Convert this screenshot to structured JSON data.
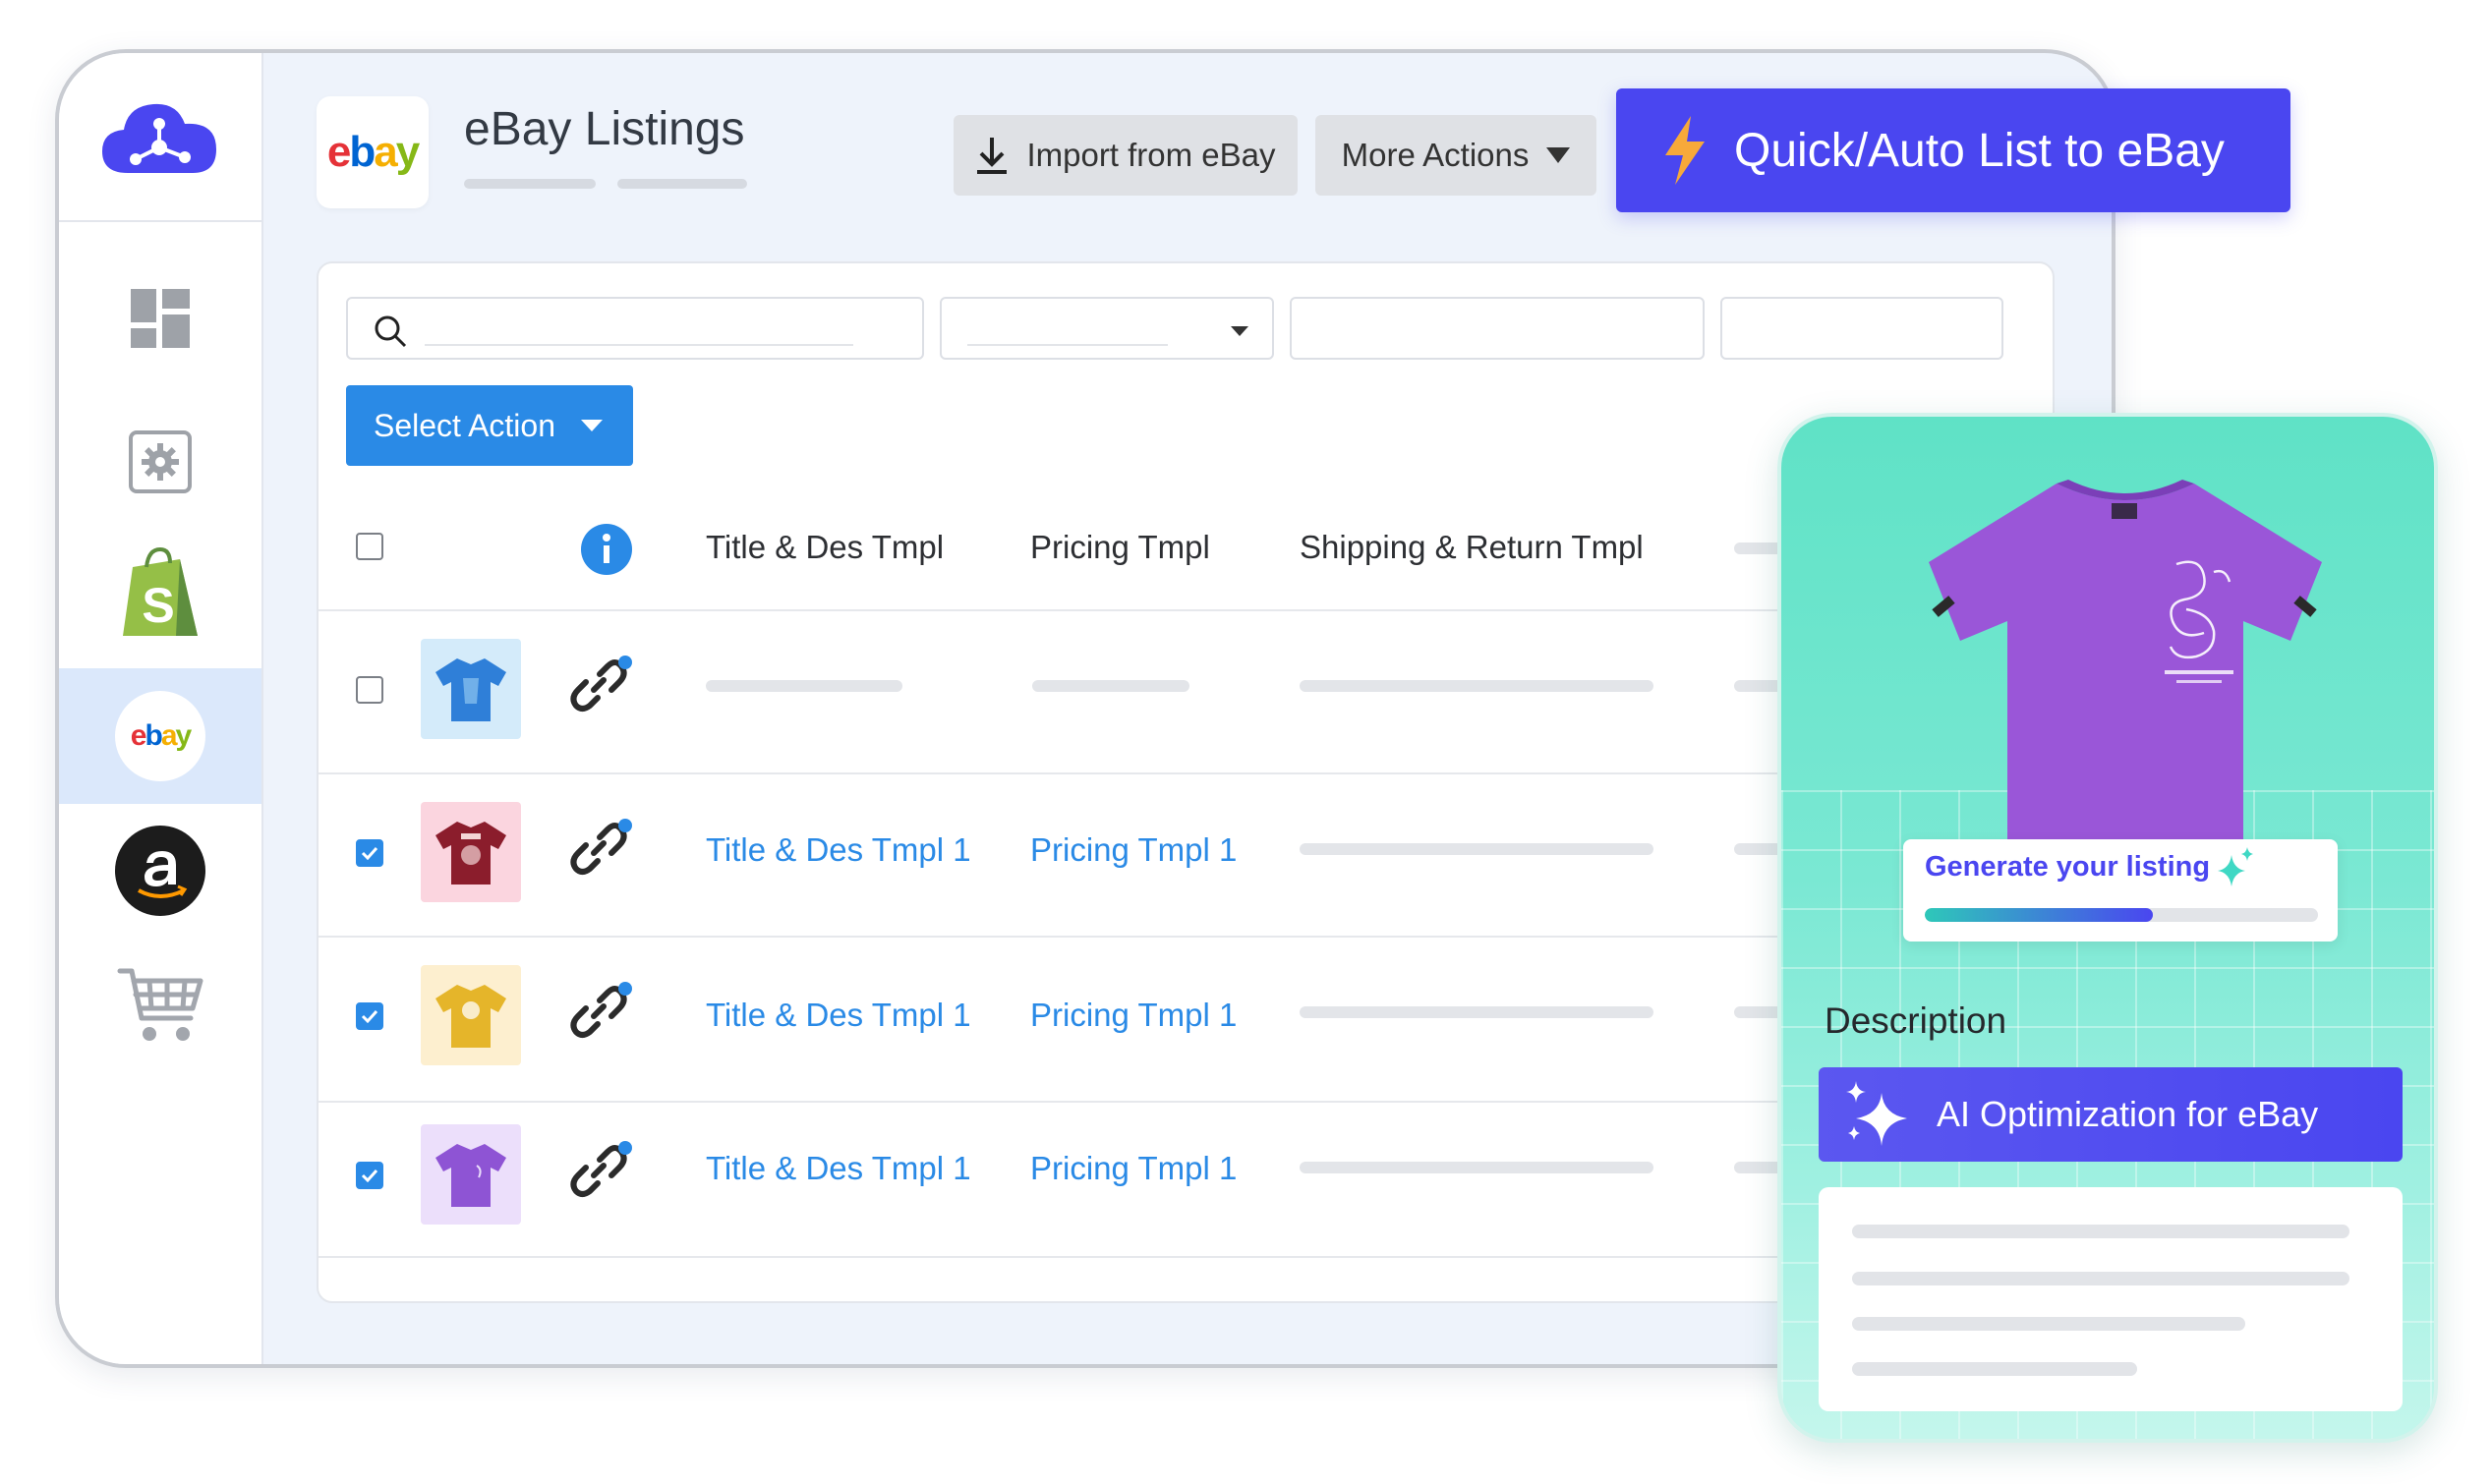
{
  "header": {
    "title": "eBay Listings",
    "import_button": "Import from eBay",
    "more_actions_button": "More Actions",
    "quick_list_button": "Quick/Auto List to eBay"
  },
  "sidebar": {
    "items": [
      {
        "name": "logo",
        "icon": "cloud-network-icon",
        "color": "#4a46f0"
      },
      {
        "name": "dashboard",
        "icon": "dashboard-grid-icon"
      },
      {
        "name": "settings",
        "icon": "gear-icon"
      },
      {
        "name": "shopify",
        "icon": "shopify-bag-icon",
        "color": "#95bf47"
      },
      {
        "name": "ebay",
        "icon": "ebay-logo-icon",
        "active": true
      },
      {
        "name": "amazon",
        "icon": "amazon-logo-icon"
      },
      {
        "name": "cart",
        "icon": "cart-icon"
      }
    ],
    "ebay_logo": {
      "e": "e",
      "b": "b",
      "a": "a",
      "y": "y"
    }
  },
  "toolbar": {
    "select_action": "Select Action"
  },
  "table": {
    "columns": [
      "Title & Des Tmpl",
      "Pricing Tmpl",
      "Shipping & Return Tmpl"
    ],
    "rows": [
      {
        "checked": false,
        "thumb_color": "#2f7fd8",
        "thumb_bg": "#d4ebfa",
        "title_tmpl": "",
        "pricing_tmpl": ""
      },
      {
        "checked": true,
        "thumb_color": "#8b1d2c",
        "thumb_bg": "#fbd5df",
        "title_tmpl": "Title & Des Tmpl 1",
        "pricing_tmpl": "Pricing Tmpl 1"
      },
      {
        "checked": true,
        "thumb_color": "#e5b52a",
        "thumb_bg": "#fdefcf",
        "title_tmpl": "Title & Des Tmpl 1",
        "pricing_tmpl": "Pricing Tmpl 1"
      },
      {
        "checked": true,
        "thumb_color": "#8e54d4",
        "thumb_bg": "#ecdffb",
        "title_tmpl": "Title & Des Tmpl 1",
        "pricing_tmpl": "Pricing Tmpl 1"
      }
    ]
  },
  "ai_card": {
    "generate_label": "Generate your listing",
    "progress": 0.58,
    "description_label": "Description",
    "ai_button": "AI Optimization for eBay",
    "shirt_color": "#9a56d8"
  },
  "colors": {
    "accent": "#4a46f0",
    "link": "#2a8ae6",
    "card_gradient_top": "#5fe2c6"
  }
}
